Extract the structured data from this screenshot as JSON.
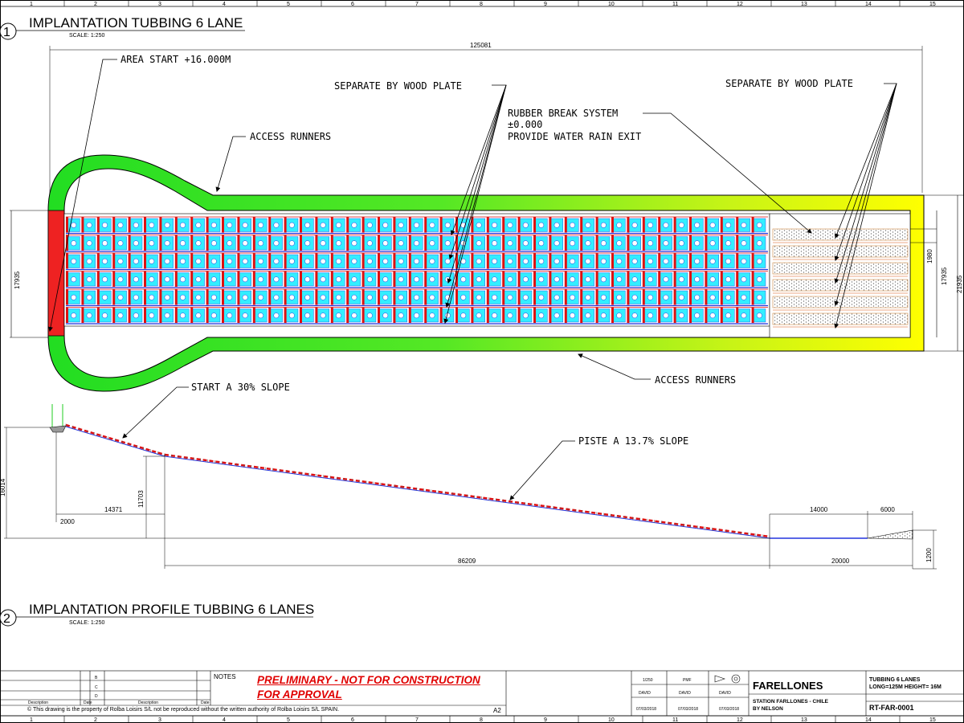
{
  "grid_top": [
    "1",
    "2",
    "3",
    "4",
    "5",
    "6",
    "7",
    "8",
    "9",
    "10",
    "11",
    "12",
    "13",
    "14",
    "15"
  ],
  "grid_bottom": [
    "1",
    "2",
    "3",
    "4",
    "5",
    "6",
    "7",
    "8",
    "9",
    "10",
    "11",
    "12",
    "13",
    "14",
    "15"
  ],
  "view1": {
    "number": "1",
    "title": "IMPLANTATION TUBBING 6 LANE",
    "scale": "SCALE: 1:250",
    "labels": {
      "area_start": "AREA START +16.000M",
      "separate_1": "SEPARATE BY WOOD PLATE",
      "separate_2": "SEPARATE BY WOOD PLATE",
      "rubber_1": "RUBBER BREAK SYSTEM",
      "rubber_2": "±0.000",
      "rubber_3": "PROVIDE WATER RAIN EXIT",
      "access_top": "ACCESS RUNNERS",
      "access_bottom": "ACCESS RUNNERS"
    },
    "dims": {
      "overall_length": "125081",
      "left_width": "17935",
      "right_width": "17935",
      "outer_width": "21935",
      "lane_width": "1980"
    }
  },
  "view2": {
    "number": "2",
    "title": "IMPLANTATION PROFILE TUBBING 6 LANES",
    "scale": "SCALE: 1:250",
    "labels": {
      "start_slope": "START A 30% SLOPE",
      "piste_slope": "PISTE A 13.7% SLOPE"
    },
    "dims": {
      "height_total": "16014",
      "start_platform": "2000",
      "first_run": "14371",
      "mid_height": "11703",
      "main_run": "86209",
      "flat_a": "14000",
      "flat_b": "6000",
      "flat_total": "20000",
      "end_height": "1200"
    }
  },
  "title_block": {
    "notes_label": "NOTES",
    "warning_1": "PRELIMINARY - NOT FOR CONSTRUCTION",
    "warning_2": "FOR APPROVAL",
    "copyright": "This drawing is the property of  Rolba Loisirs S/L not be reproduced without the written authority of Rolba Loisirs S/L SPAIN.",
    "sheet_size": "A2",
    "rev_letters": [
      "B",
      "C",
      "D"
    ],
    "rev_headers": [
      "Description",
      "Date",
      "Description",
      "Date"
    ],
    "scale_value": "1/250",
    "format_value": "PMF",
    "drawn_by": "DAVID",
    "checked_by": "DAVID",
    "approved_by": "DAVID",
    "date_1": "07/03/2018",
    "date_2": "07/03/2018",
    "date_3": "07/03/2018",
    "client": "FARELLONES",
    "site_1": "STATION FARLLONES - CHILE",
    "site_2": "BY NELSON",
    "project_1": "TUBBING 6 LANES",
    "project_2": "LONG=125M HEIGHT= 16M",
    "drawing_number": "RT-FAR-0001"
  },
  "colors": {
    "start_area": "#ee2222",
    "runners_green": "#22dd22",
    "runners_yellow": "#ffff00",
    "lane_cell": "#33eeff",
    "lane_edge": "#dd1111",
    "lane_blue": "#2233dd",
    "warning": "#e00000"
  }
}
